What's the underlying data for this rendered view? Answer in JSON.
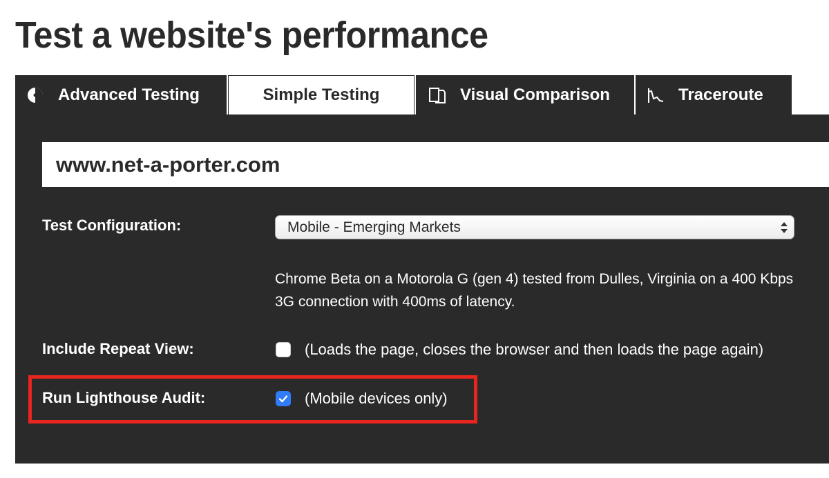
{
  "page": {
    "title": "Test a website's performance"
  },
  "tabs": [
    {
      "label": "Advanced Testing",
      "icon": "dial-icon",
      "active": false
    },
    {
      "label": "Simple Testing",
      "icon": "",
      "active": true
    },
    {
      "label": "Visual Comparison",
      "icon": "compare-pages-icon",
      "active": false
    },
    {
      "label": "Traceroute",
      "icon": "traceroute-graph-icon",
      "active": false
    }
  ],
  "form": {
    "url_value": "www.net-a-porter.com",
    "test_configuration": {
      "label": "Test Configuration:",
      "selected": "Mobile - Emerging Markets",
      "description": "Chrome Beta on a Motorola G (gen 4) tested from Dulles, Virginia on a 400 Kbps 3G connection with 400ms of latency."
    },
    "repeat_view": {
      "label": "Include Repeat View:",
      "checked": false,
      "note": "(Loads the page, closes the browser and then loads the page again)"
    },
    "lighthouse": {
      "label": "Run Lighthouse Audit:",
      "checked": true,
      "note": "(Mobile devices only)"
    }
  },
  "colors": {
    "panel_bg": "#2a2a2a",
    "checkbox_checked": "#2f7cf6",
    "highlight_outline": "#e8251f"
  }
}
